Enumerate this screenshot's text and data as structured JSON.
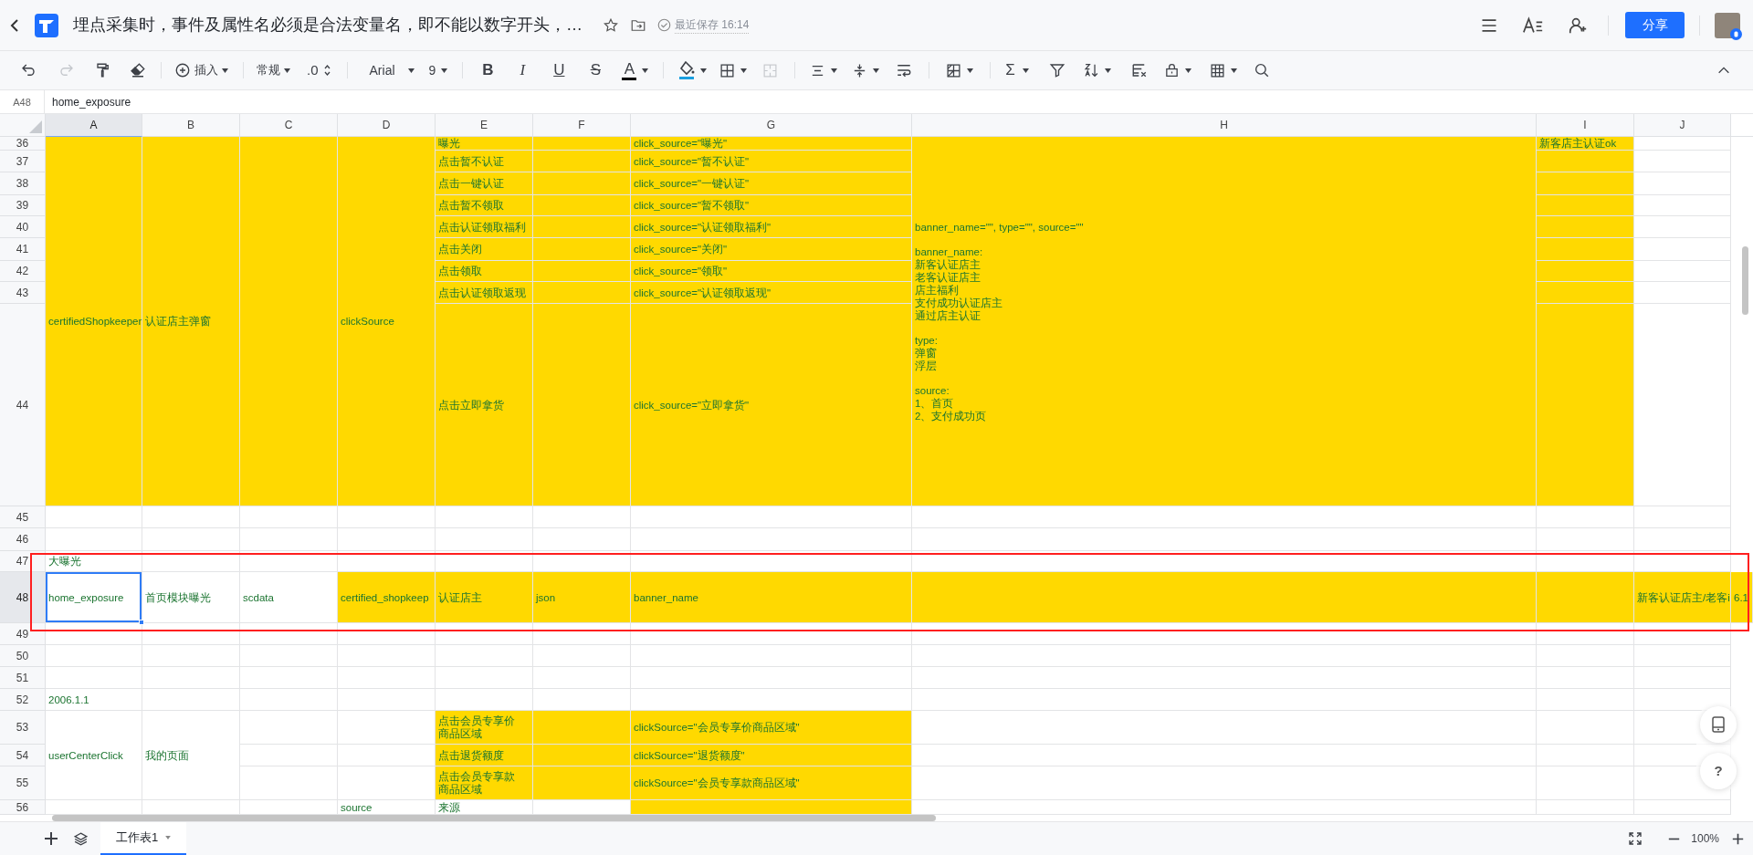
{
  "title_bar": {
    "document_title": "埋点采集时，事件及属性名必须是合法变量名，即不能以数字开头，…",
    "save_status": "最近保存 16:14",
    "share_button": "分享"
  },
  "toolbar": {
    "undo": {
      "disabled": false
    },
    "redo": {
      "disabled": true
    },
    "insert_label": "插入",
    "number_format": "常规",
    "decimal": ".0",
    "font": "Arial",
    "font_size": "9",
    "bold": "B",
    "italic": "I",
    "underline": "U",
    "strikethrough": "S",
    "text_color": "A",
    "merge": {
      "disabled": true
    },
    "sum": "Σ"
  },
  "formula_bar": {
    "cell_reference": "A48",
    "value": "home_exposure"
  },
  "columns": [
    {
      "label": "A",
      "selected": true
    },
    {
      "label": "B",
      "selected": false
    },
    {
      "label": "C",
      "selected": false
    },
    {
      "label": "D",
      "selected": false
    },
    {
      "label": "E",
      "selected": false
    },
    {
      "label": "F",
      "selected": false
    },
    {
      "label": "G",
      "selected": false
    },
    {
      "label": "H",
      "selected": false
    },
    {
      "label": "I",
      "selected": false
    },
    {
      "label": "J",
      "selected": false
    }
  ],
  "rows": [
    {
      "number": "36",
      "selected": false,
      "outlined": false,
      "cells": [
        {
          "kind": "cell",
          "text": "certifiedShopkeeper",
          "highlighted": true
        },
        {
          "kind": "cell",
          "text": "认证店主弹窗",
          "highlighted": true
        },
        {
          "kind": "cell",
          "highlighted": true
        },
        {
          "kind": "cell",
          "text": "clickSource",
          "highlighted": true
        },
        {
          "kind": "cell",
          "text": "曝光",
          "highlighted": true
        },
        {
          "kind": "cell",
          "highlighted": true
        },
        {
          "kind": "cell",
          "text": "click_source=\"曝光\"",
          "highlighted": true
        },
        {
          "kind": "cell",
          "paragraphs": [
            [
              "banner_name=\"\", type=\"\", source=\"\""
            ],
            [
              "banner_name:",
              "新客认证店主",
              "老客认证店主",
              "店主福利",
              "支付成功认证店主",
              "通过店主认证"
            ],
            [
              "type:",
              "弹窗",
              "浮层"
            ],
            [
              "source:",
              "1、首页",
              "2、支付成功页"
            ]
          ],
          "highlighted": true
        },
        {
          "kind": "cell",
          "text": "新客店主认证ok",
          "highlighted": true
        },
        {
          "kind": "cell",
          "highlighted": false
        }
      ]
    },
    {
      "number": "37",
      "selected": false,
      "outlined": false,
      "cells": [
        {
          "kind": "merged"
        },
        {
          "kind": "merged"
        },
        {
          "kind": "merged"
        },
        {
          "kind": "merged"
        },
        {
          "kind": "cell",
          "text": "点击暂不认证",
          "highlighted": true
        },
        {
          "kind": "cell",
          "highlighted": true
        },
        {
          "kind": "cell",
          "text": "click_source=\"暂不认证\"",
          "highlighted": true
        },
        {
          "kind": "merged"
        },
        {
          "kind": "cell",
          "highlighted": true
        },
        {
          "kind": "cell",
          "highlighted": false
        }
      ]
    },
    {
      "number": "38",
      "selected": false,
      "outlined": false,
      "cells": [
        {
          "kind": "merged"
        },
        {
          "kind": "merged"
        },
        {
          "kind": "merged"
        },
        {
          "kind": "merged"
        },
        {
          "kind": "cell",
          "text": "点击一键认证",
          "highlighted": true
        },
        {
          "kind": "cell",
          "highlighted": true
        },
        {
          "kind": "cell",
          "text": "click_source=\"一键认证\"",
          "highlighted": true
        },
        {
          "kind": "merged"
        },
        {
          "kind": "cell",
          "highlighted": true
        },
        {
          "kind": "cell",
          "highlighted": false
        }
      ]
    },
    {
      "number": "39",
      "selected": false,
      "outlined": false,
      "cells": [
        {
          "kind": "merged"
        },
        {
          "kind": "merged"
        },
        {
          "kind": "merged"
        },
        {
          "kind": "merged"
        },
        {
          "kind": "cell",
          "text": "点击暂不领取",
          "highlighted": true
        },
        {
          "kind": "cell",
          "highlighted": true
        },
        {
          "kind": "cell",
          "text": "click_source=\"暂不领取\"",
          "highlighted": true
        },
        {
          "kind": "merged"
        },
        {
          "kind": "cell",
          "highlighted": true
        },
        {
          "kind": "cell",
          "highlighted": false
        }
      ]
    },
    {
      "number": "40",
      "selected": false,
      "outlined": false,
      "cells": [
        {
          "kind": "merged"
        },
        {
          "kind": "merged"
        },
        {
          "kind": "merged"
        },
        {
          "kind": "merged"
        },
        {
          "kind": "cell",
          "text": "点击认证领取福利",
          "highlighted": true
        },
        {
          "kind": "cell",
          "highlighted": true
        },
        {
          "kind": "cell",
          "text": "click_source=\"认证领取福利\"",
          "highlighted": true
        },
        {
          "kind": "merged"
        },
        {
          "kind": "cell",
          "highlighted": true
        },
        {
          "kind": "cell",
          "highlighted": false
        }
      ]
    },
    {
      "number": "41",
      "selected": false,
      "outlined": false,
      "cells": [
        {
          "kind": "merged"
        },
        {
          "kind": "merged"
        },
        {
          "kind": "merged"
        },
        {
          "kind": "merged"
        },
        {
          "kind": "cell",
          "text": "点击关闭",
          "highlighted": true
        },
        {
          "kind": "cell",
          "highlighted": true
        },
        {
          "kind": "cell",
          "text": "click_source=\"关闭\"",
          "highlighted": true
        },
        {
          "kind": "merged"
        },
        {
          "kind": "cell",
          "highlighted": true
        },
        {
          "kind": "cell",
          "highlighted": false
        }
      ]
    },
    {
      "number": "42",
      "selected": false,
      "outlined": false,
      "cells": [
        {
          "kind": "merged"
        },
        {
          "kind": "merged"
        },
        {
          "kind": "merged"
        },
        {
          "kind": "merged"
        },
        {
          "kind": "cell",
          "text": "点击领取",
          "highlighted": true
        },
        {
          "kind": "cell",
          "highlighted": true
        },
        {
          "kind": "cell",
          "text": "click_source=\"领取\"",
          "highlighted": true
        },
        {
          "kind": "merged"
        },
        {
          "kind": "cell",
          "highlighted": true
        },
        {
          "kind": "cell",
          "highlighted": false
        }
      ]
    },
    {
      "number": "43",
      "selected": false,
      "outlined": false,
      "cells": [
        {
          "kind": "merged"
        },
        {
          "kind": "merged"
        },
        {
          "kind": "merged"
        },
        {
          "kind": "merged"
        },
        {
          "kind": "cell",
          "text": "点击认证领取返现",
          "highlighted": true
        },
        {
          "kind": "cell",
          "highlighted": true
        },
        {
          "kind": "cell",
          "text": "click_source=\"认证领取返现\"",
          "highlighted": true
        },
        {
          "kind": "merged"
        },
        {
          "kind": "cell",
          "highlighted": true
        },
        {
          "kind": "cell",
          "highlighted": false
        }
      ]
    },
    {
      "number": "44",
      "selected": false,
      "outlined": false,
      "cells": [
        {
          "kind": "merged"
        },
        {
          "kind": "merged"
        },
        {
          "kind": "merged"
        },
        {
          "kind": "merged"
        },
        {
          "kind": "cell",
          "text": "点击立即拿货",
          "highlighted": true
        },
        {
          "kind": "cell",
          "highlighted": true
        },
        {
          "kind": "cell",
          "text": "click_source=\"立即拿货\"",
          "highlighted": true
        },
        {
          "kind": "merged"
        },
        {
          "kind": "cell",
          "highlighted": true
        },
        {
          "kind": "cell",
          "highlighted": false
        }
      ]
    },
    {
      "number": "45",
      "selected": false,
      "outlined": false,
      "cells": [
        {
          "kind": "cell",
          "highlighted": false
        },
        {
          "kind": "cell",
          "highlighted": false
        },
        {
          "kind": "cell",
          "highlighted": false
        },
        {
          "kind": "cell",
          "highlighted": false
        },
        {
          "kind": "cell",
          "highlighted": false
        },
        {
          "kind": "cell",
          "highlighted": false
        },
        {
          "kind": "cell",
          "highlighted": false
        },
        {
          "kind": "cell",
          "highlighted": false
        },
        {
          "kind": "cell",
          "highlighted": false
        },
        {
          "kind": "cell",
          "highlighted": false
        }
      ]
    },
    {
      "number": "46",
      "selected": false,
      "outlined": false,
      "cells": [
        {
          "kind": "cell",
          "highlighted": false
        },
        {
          "kind": "cell",
          "highlighted": false
        },
        {
          "kind": "cell",
          "highlighted": false
        },
        {
          "kind": "cell",
          "highlighted": false
        },
        {
          "kind": "cell",
          "highlighted": false
        },
        {
          "kind": "cell",
          "highlighted": false
        },
        {
          "kind": "cell",
          "highlighted": false
        },
        {
          "kind": "cell",
          "highlighted": false
        },
        {
          "kind": "cell",
          "highlighted": false
        },
        {
          "kind": "cell",
          "highlighted": false
        }
      ]
    },
    {
      "number": "47",
      "selected": false,
      "outlined": true,
      "cells": [
        {
          "kind": "cell",
          "text": "大曝光",
          "highlighted": false
        },
        {
          "kind": "cell",
          "highlighted": false
        },
        {
          "kind": "cell",
          "highlighted": false
        },
        {
          "kind": "cell",
          "highlighted": false
        },
        {
          "kind": "cell",
          "highlighted": false
        },
        {
          "kind": "cell",
          "highlighted": false
        },
        {
          "kind": "cell",
          "highlighted": false
        },
        {
          "kind": "cell",
          "highlighted": false
        },
        {
          "kind": "cell",
          "highlighted": false
        },
        {
          "kind": "cell",
          "highlighted": false
        }
      ]
    },
    {
      "number": "48",
      "selected": true,
      "outlined": true,
      "cells": [
        {
          "kind": "cell",
          "text": "home_exposure",
          "highlighted": false,
          "selected": true
        },
        {
          "kind": "cell",
          "text": "首页模块曝光",
          "highlighted": false
        },
        {
          "kind": "cell",
          "text": "scdata",
          "highlighted": false
        },
        {
          "kind": "cell",
          "text": "certified_shopkeep",
          "highlighted": true
        },
        {
          "kind": "cell",
          "text": "认证店主",
          "highlighted": true
        },
        {
          "kind": "cell",
          "text": "json",
          "highlighted": true
        },
        {
          "kind": "cell",
          "text": "banner_name",
          "highlighted": true
        },
        {
          "kind": "cell",
          "highlighted": true
        },
        {
          "kind": "cell",
          "highlighted": true
        },
        {
          "kind": "cell",
          "text": "新客认证店主/老客i",
          "highlighted": true
        },
        {
          "kind": "cell",
          "text": "6.1",
          "highlighted": true
        }
      ]
    },
    {
      "number": "49",
      "selected": false,
      "outlined": false,
      "cells": [
        {
          "kind": "cell",
          "highlighted": false
        },
        {
          "kind": "cell",
          "highlighted": false
        },
        {
          "kind": "cell",
          "highlighted": false
        },
        {
          "kind": "cell",
          "highlighted": false
        },
        {
          "kind": "cell",
          "highlighted": false
        },
        {
          "kind": "cell",
          "highlighted": false
        },
        {
          "kind": "cell",
          "highlighted": false
        },
        {
          "kind": "cell",
          "highlighted": false
        },
        {
          "kind": "cell",
          "highlighted": false
        },
        {
          "kind": "cell",
          "highlighted": false
        }
      ]
    },
    {
      "number": "50",
      "selected": false,
      "outlined": false,
      "cells": [
        {
          "kind": "cell",
          "highlighted": false
        },
        {
          "kind": "cell",
          "highlighted": false
        },
        {
          "kind": "cell",
          "highlighted": false
        },
        {
          "kind": "cell",
          "highlighted": false
        },
        {
          "kind": "cell",
          "highlighted": false
        },
        {
          "kind": "cell",
          "highlighted": false
        },
        {
          "kind": "cell",
          "highlighted": false
        },
        {
          "kind": "cell",
          "highlighted": false
        },
        {
          "kind": "cell",
          "highlighted": false
        },
        {
          "kind": "cell",
          "highlighted": false
        }
      ]
    },
    {
      "number": "51",
      "selected": false,
      "outlined": false,
      "cells": [
        {
          "kind": "cell",
          "highlighted": false
        },
        {
          "kind": "cell",
          "highlighted": false
        },
        {
          "kind": "cell",
          "highlighted": false
        },
        {
          "kind": "cell",
          "highlighted": false
        },
        {
          "kind": "cell",
          "highlighted": false
        },
        {
          "kind": "cell",
          "highlighted": false
        },
        {
          "kind": "cell",
          "highlighted": false
        },
        {
          "kind": "cell",
          "highlighted": false
        },
        {
          "kind": "cell",
          "highlighted": false
        },
        {
          "kind": "cell",
          "highlighted": false
        }
      ]
    },
    {
      "number": "52",
      "selected": false,
      "outlined": false,
      "cells": [
        {
          "kind": "cell",
          "text": "2006.1.1",
          "highlighted": false
        },
        {
          "kind": "cell",
          "highlighted": false
        },
        {
          "kind": "cell",
          "highlighted": false
        },
        {
          "kind": "cell",
          "highlighted": false
        },
        {
          "kind": "cell",
          "highlighted": false
        },
        {
          "kind": "cell",
          "highlighted": false
        },
        {
          "kind": "cell",
          "highlighted": false
        },
        {
          "kind": "cell",
          "highlighted": false
        },
        {
          "kind": "cell",
          "highlighted": false
        },
        {
          "kind": "cell",
          "highlighted": false
        }
      ]
    },
    {
      "number": "53",
      "selected": false,
      "outlined": false,
      "cells": [
        {
          "kind": "cell",
          "text": "userCenterClick",
          "highlighted": false
        },
        {
          "kind": "cell",
          "text": "我的页面",
          "highlighted": false
        },
        {
          "kind": "cell",
          "highlighted": false
        },
        {
          "kind": "cell",
          "highlighted": false
        },
        {
          "kind": "cell",
          "paragraphs": [
            [
              "点击会员专享价",
              "商品区域"
            ]
          ],
          "highlighted": true
        },
        {
          "kind": "cell",
          "highlighted": true
        },
        {
          "kind": "cell",
          "text": "clickSource=\"会员专享价商品区域\"",
          "highlighted": true
        },
        {
          "kind": "cell",
          "highlighted": false
        },
        {
          "kind": "cell",
          "highlighted": false
        },
        {
          "kind": "cell",
          "highlighted": false
        }
      ]
    },
    {
      "number": "54",
      "selected": false,
      "outlined": false,
      "cells": [
        {
          "kind": "merged"
        },
        {
          "kind": "merged"
        },
        {
          "kind": "cell",
          "highlighted": false
        },
        {
          "kind": "cell",
          "highlighted": false
        },
        {
          "kind": "cell",
          "text": "点击退货额度",
          "highlighted": true
        },
        {
          "kind": "cell",
          "highlighted": true
        },
        {
          "kind": "cell",
          "text": "clickSource=\"退货额度\"",
          "highlighted": true
        },
        {
          "kind": "cell",
          "highlighted": false
        },
        {
          "kind": "cell",
          "highlighted": false
        },
        {
          "kind": "cell",
          "highlighted": false
        }
      ]
    },
    {
      "number": "55",
      "selected": false,
      "outlined": false,
      "cells": [
        {
          "kind": "merged"
        },
        {
          "kind": "merged"
        },
        {
          "kind": "cell",
          "highlighted": false
        },
        {
          "kind": "cell",
          "highlighted": false
        },
        {
          "kind": "cell",
          "paragraphs": [
            [
              "点击会员专享款",
              "商品区域"
            ]
          ],
          "highlighted": true
        },
        {
          "kind": "cell",
          "highlighted": true
        },
        {
          "kind": "cell",
          "text": "clickSource=\"会员专享款商品区域\"",
          "highlighted": true
        },
        {
          "kind": "cell",
          "highlighted": false
        },
        {
          "kind": "cell",
          "highlighted": false
        },
        {
          "kind": "cell",
          "highlighted": false
        }
      ]
    },
    {
      "number": "56",
      "selected": false,
      "outlined": false,
      "cells": [
        {
          "kind": "cell",
          "highlighted": false
        },
        {
          "kind": "cell",
          "highlighted": false
        },
        {
          "kind": "cell",
          "highlighted": false
        },
        {
          "kind": "cell",
          "text": "source",
          "highlighted": false
        },
        {
          "kind": "cell",
          "text": "来源",
          "highlighted": false
        },
        {
          "kind": "cell",
          "highlighted": false
        },
        {
          "kind": "cell",
          "highlighted": true
        },
        {
          "kind": "cell",
          "highlighted": false
        },
        {
          "kind": "cell",
          "highlighted": false
        },
        {
          "kind": "cell",
          "highlighted": false
        }
      ]
    }
  ],
  "side_buttons": {
    "help": "?"
  },
  "sheet_tabs": [
    {
      "label": "工作表1",
      "selected": true
    }
  ],
  "zoom": "100%"
}
